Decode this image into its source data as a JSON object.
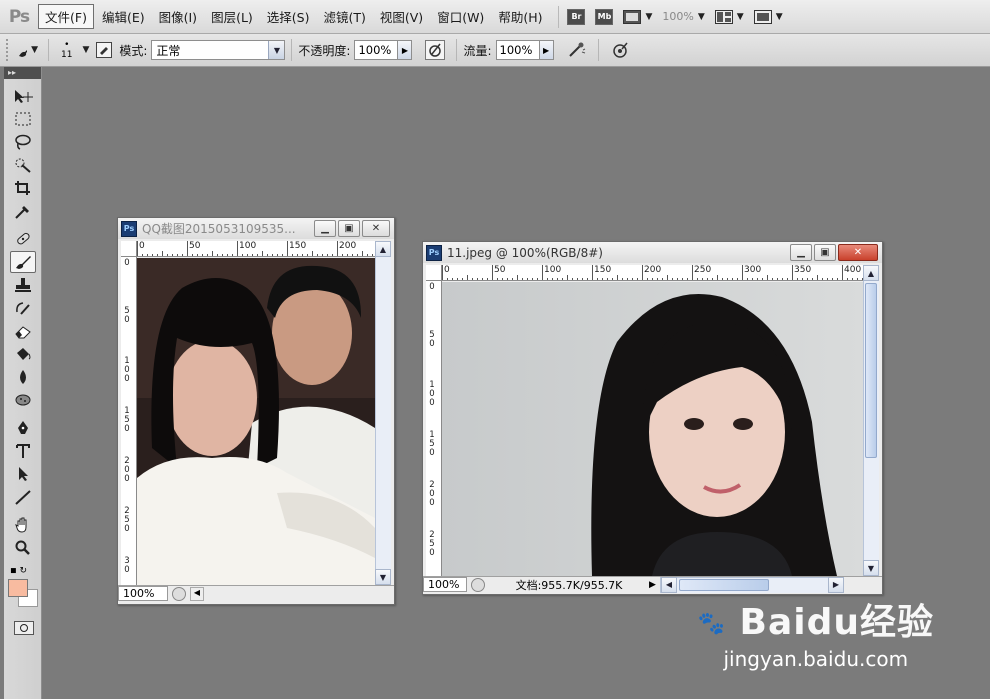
{
  "app": {
    "logo": "Ps"
  },
  "menu": {
    "items": [
      "文件(F)",
      "编辑(E)",
      "图像(I)",
      "图层(L)",
      "选择(S)",
      "滤镜(T)",
      "视图(V)",
      "窗口(W)",
      "帮助(H)"
    ],
    "bridge": "Br",
    "minibridge": "Mb",
    "zoom": "100%"
  },
  "options": {
    "brush_size": "11",
    "mode_label": "模式:",
    "mode_value": "正常",
    "opacity_label": "不透明度:",
    "opacity_value": "100%",
    "flow_label": "流量:",
    "flow_value": "100%"
  },
  "doc1": {
    "title": "QQ截图2015053109535...",
    "ruler_top": [
      "0",
      "50",
      "100",
      "150",
      "200"
    ],
    "ruler_left": [
      [
        "0"
      ],
      [
        "5",
        "0"
      ],
      [
        "1",
        "0",
        "0"
      ],
      [
        "1",
        "5",
        "0"
      ],
      [
        "2",
        "0",
        "0"
      ],
      [
        "2",
        "5",
        "0"
      ],
      [
        "3",
        "0"
      ]
    ],
    "zoom": "100%"
  },
  "doc2": {
    "title": "11.jpeg @ 100%(RGB/8#)",
    "ruler_top": [
      "0",
      "50",
      "100",
      "150",
      "200",
      "250",
      "300",
      "350",
      "400"
    ],
    "ruler_left": [
      [
        "0"
      ],
      [
        "5",
        "0"
      ],
      [
        "1",
        "0",
        "0"
      ],
      [
        "1",
        "5",
        "0"
      ],
      [
        "2",
        "0",
        "0"
      ],
      [
        "2",
        "5",
        "0"
      ]
    ],
    "zoom": "100%",
    "doc_size": "文档:955.7K/955.7K"
  },
  "watermark": {
    "logo": "Baidu经验",
    "url": "jingyan.baidu.com"
  },
  "colors": {
    "foreground": "#f8bba0",
    "background": "#ffffff",
    "workspace": "#7b7b7b"
  }
}
